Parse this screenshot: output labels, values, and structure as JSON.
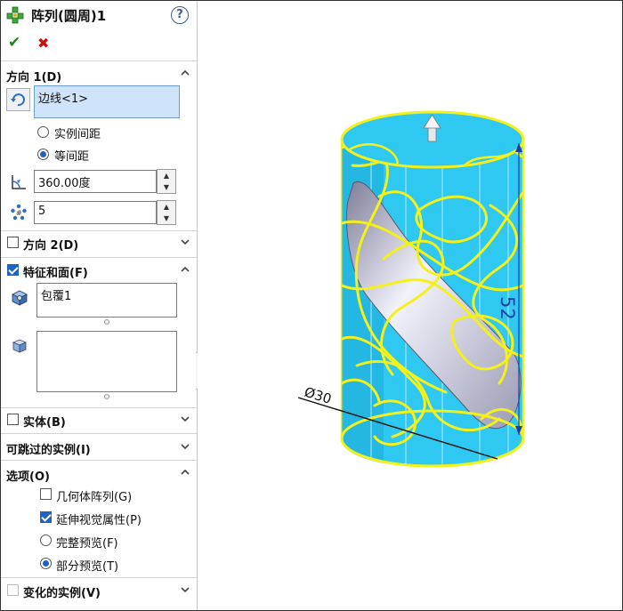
{
  "header": {
    "title": "阵列(圆周)1",
    "help": "?"
  },
  "actions": {
    "ok": "✔",
    "cancel": "✖"
  },
  "direction1": {
    "title": "方向 1(D)",
    "reference": "边线<1>",
    "spacing_options": [
      {
        "label": "实例间距",
        "selected": false
      },
      {
        "label": "等间距",
        "selected": true
      }
    ],
    "angle": "360.00度",
    "count": "5"
  },
  "direction2": {
    "title": "方向 2(D)",
    "checked": false
  },
  "features": {
    "title": "特征和面(F)",
    "checked": true,
    "features_list": [
      "包覆1"
    ],
    "faces_list": []
  },
  "bodies": {
    "title": "实体(B)",
    "checked": false
  },
  "skip_instances": {
    "title": "可跳过的实例(I)"
  },
  "options": {
    "title": "选项(O)",
    "geometry_pattern": {
      "label": "几何体阵列(G)",
      "checked": false
    },
    "propagate_visual": {
      "label": "延伸视觉属性(P)",
      "checked": true
    },
    "preview_options": [
      {
        "label": "完整预览(F)",
        "selected": false
      },
      {
        "label": "部分预览(T)",
        "selected": true
      }
    ]
  },
  "varying_instances": {
    "title": "变化的实例(V)",
    "checked": false
  },
  "viewport": {
    "dimension_height": "52",
    "dimension_diameter": "Ø30",
    "colors": {
      "cylinder": "#2ec9f2",
      "curves": "#f4f01a",
      "cut": "#b8b8cc"
    }
  }
}
